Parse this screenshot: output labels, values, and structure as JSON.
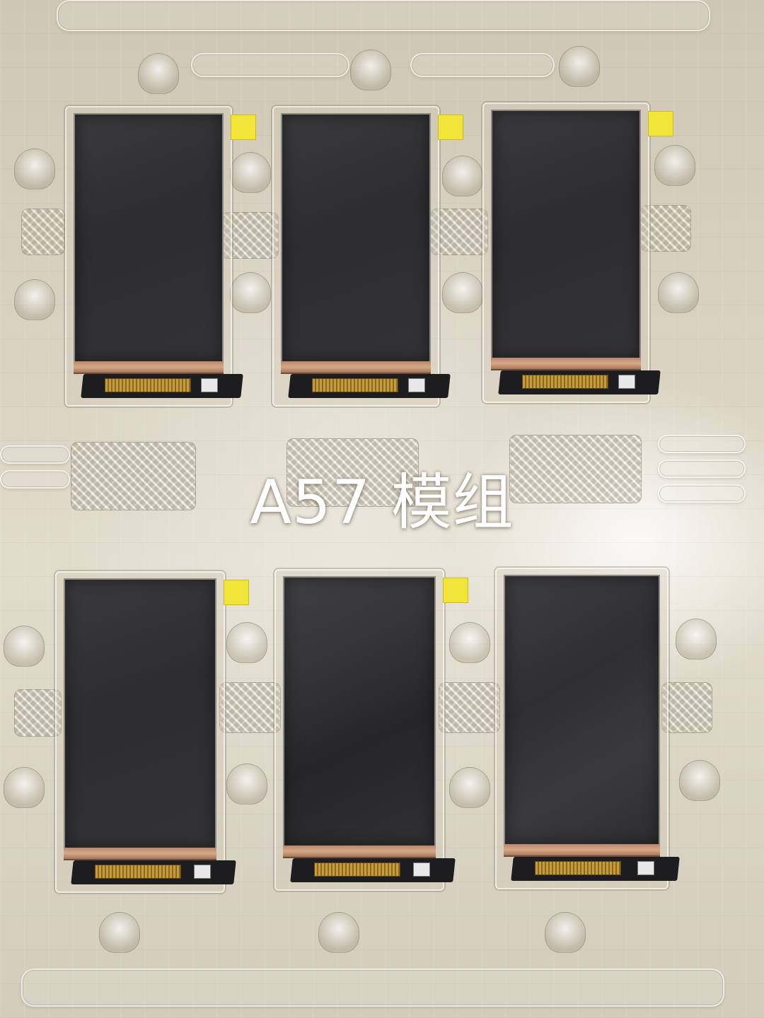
{
  "photo": {
    "caption": "A57 模组"
  },
  "modules": [
    {
      "row": 1,
      "col": 1,
      "has_yellow_tab": true
    },
    {
      "row": 1,
      "col": 2,
      "has_yellow_tab": true
    },
    {
      "row": 1,
      "col": 3,
      "has_yellow_tab": true
    },
    {
      "row": 2,
      "col": 1,
      "has_yellow_tab": true
    },
    {
      "row": 2,
      "col": 2,
      "has_yellow_tab": true
    },
    {
      "row": 2,
      "col": 3,
      "has_yellow_tab": false
    }
  ],
  "colors": {
    "screen": "#2f2f31",
    "tray": "#d9d2c2",
    "tab": "#f2e53a",
    "caption": "#ffffff"
  }
}
